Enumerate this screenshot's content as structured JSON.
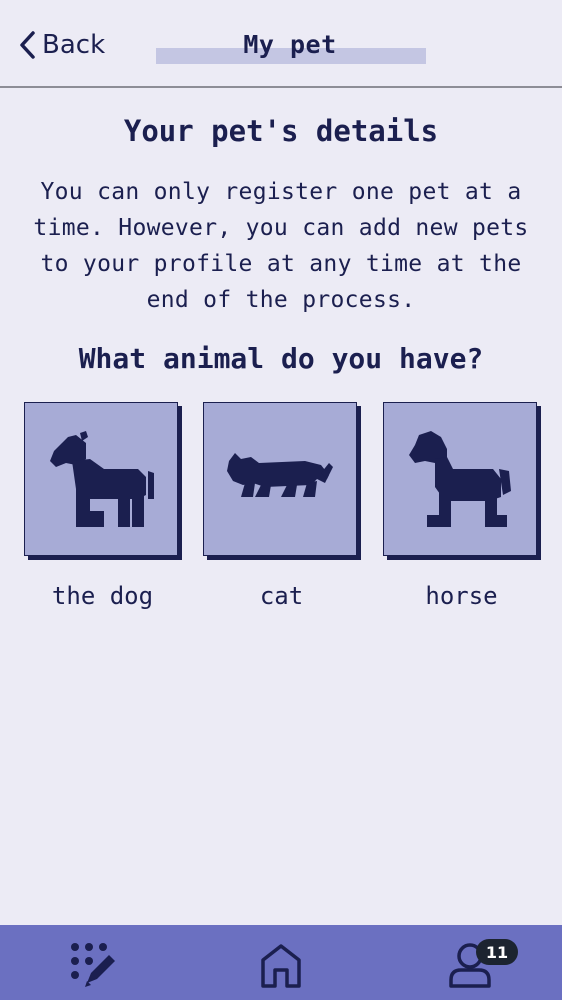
{
  "header": {
    "back_label": "Back",
    "title": "My pet"
  },
  "content": {
    "section_title": "Your pet's details",
    "intro": "You can only register one pet at a time. However, you can add new pets to your profile at any time at the end of the process.",
    "question": "What animal do you have?"
  },
  "options": [
    {
      "label": "the dog",
      "icon": "dog-icon"
    },
    {
      "label": "cat",
      "icon": "cat-icon"
    },
    {
      "label": "horse",
      "icon": "horse-icon"
    }
  ],
  "bottom_nav": {
    "items": [
      {
        "icon": "dots-pencil-icon"
      },
      {
        "icon": "home-icon"
      },
      {
        "icon": "user-icon"
      }
    ],
    "profile_badge": "11"
  },
  "colors": {
    "background": "#ecebf5",
    "text": "#1b1f4f",
    "tile": "#a7abd6",
    "nav": "#6b70c1",
    "badge": "#1c2430"
  }
}
